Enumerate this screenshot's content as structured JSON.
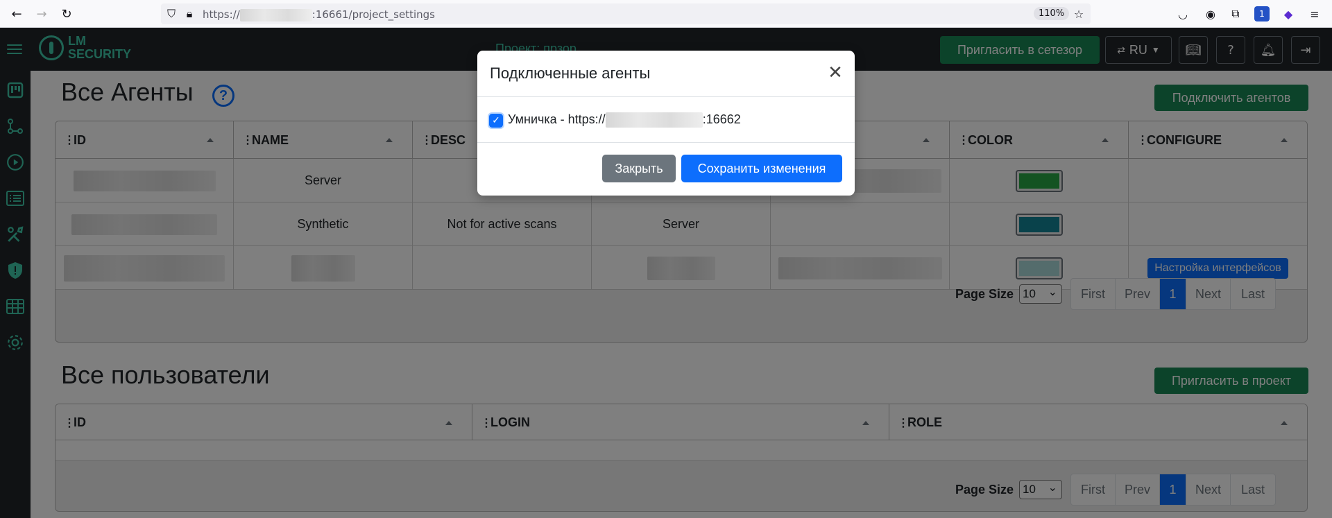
{
  "browser": {
    "url_prefix": "https://",
    "url_suffix": ":16661/project_settings",
    "zoom": "110%",
    "badge_count": "1"
  },
  "header": {
    "logo_line1": "LM",
    "logo_line2": "SECURITY",
    "project_label": "Проект: прзор",
    "invite_network_button": "Пригласить в сетезор",
    "language": "RU"
  },
  "sidebar": {
    "items": [
      "board-icon",
      "graph-icon",
      "play-icon",
      "list-icon",
      "tools-icon",
      "shield-icon",
      "table-icon",
      "gear-icon"
    ]
  },
  "agents_section": {
    "title": "Все Агенты",
    "connect_button": "Подключить агентов",
    "columns": [
      "ID",
      "NAME",
      "DESC",
      "",
      "",
      "COLOR",
      "CONFIGURE"
    ],
    "rows": [
      {
        "name": "Server",
        "description": "",
        "type": "",
        "color": "#28a745",
        "configure": ""
      },
      {
        "name": "Synthetic",
        "description": "Not for active scans",
        "type": "Server",
        "color": "#138496",
        "configure": ""
      },
      {
        "name": "",
        "description": "",
        "type": "",
        "color": "#a8d8d8",
        "configure": "Настройка интерфейсов"
      }
    ],
    "pager": {
      "page_size_label": "Page Size",
      "page_size": "10",
      "first": "First",
      "prev": "Prev",
      "current": "1",
      "next": "Next",
      "last": "Last"
    }
  },
  "users_section": {
    "title": "Все пользователи",
    "invite_button": "Пригласить в проект",
    "columns": [
      "ID",
      "LOGIN",
      "ROLE"
    ],
    "pager": {
      "page_size_label": "Page Size",
      "page_size": "10",
      "first": "First",
      "prev": "Prev",
      "current": "1",
      "next": "Next",
      "last": "Last"
    }
  },
  "modal": {
    "title": "Подключенные агенты",
    "agent_label_prefix": "Умничка - https://",
    "agent_label_suffix": ":16662",
    "agent_checked": true,
    "close_button": "Закрыть",
    "save_button": "Сохранить изменения"
  }
}
